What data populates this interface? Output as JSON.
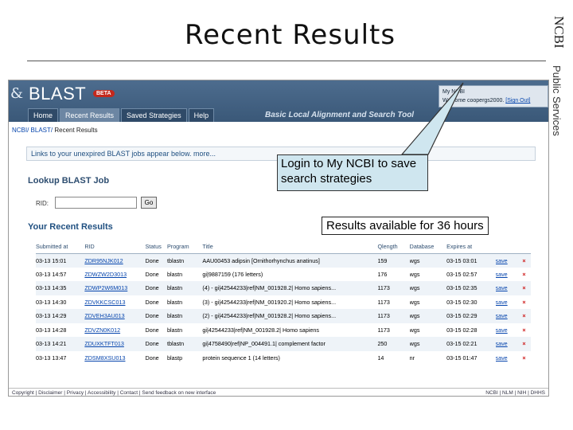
{
  "slide": {
    "title": "Recent Results",
    "side_brand": "NCBI",
    "side_label": "Public Services"
  },
  "blast": {
    "logo_text": "BLAST",
    "beta_badge": "BETA",
    "nav_tabs": [
      "Home",
      "Recent Results",
      "Saved Strategies",
      "Help"
    ],
    "tagline": "Basic Local Alignment and Search Tool",
    "signin_line1": "My NCBI",
    "signin_line2": "Welcome coopergs2000.",
    "signout_label": "[Sign Out]",
    "breadcrumb_prefix": "NCBI/ BLAST/",
    "breadcrumb_current": "Recent Results",
    "unexpired_text": "Links to your unexpired BLAST jobs appear below. more...",
    "lookup_heading": "Lookup BLAST Job",
    "rid_label": "RID:",
    "go_label": "Go",
    "results_heading": "Your Recent Results",
    "columns": [
      "Submitted at",
      "RID",
      "Status",
      "Program",
      "Title",
      "Qlength",
      "Database",
      "Expires at",
      "",
      ""
    ],
    "rows": [
      [
        "03-13 15:01",
        "ZDR95NJK012",
        "Done",
        "tblastn",
        "AAU00453 adipsin [Ornithorhynchus anatinus]",
        "159",
        "wgs",
        "03-15 03:01",
        "save",
        "×"
      ],
      [
        "03-13 14:57",
        "ZDWZW2D3013",
        "Done",
        "blastn",
        "gi|9887159 (176 letters)",
        "176",
        "wgs",
        "03-15 02:57",
        "save",
        "×"
      ],
      [
        "03-13 14:35",
        "ZDWP2W6M013",
        "Done",
        "blastn",
        "(4) - gi|42544233|ref|NM_001928.2| Homo sapiens...",
        "1173",
        "wgs",
        "03-15 02:35",
        "save",
        "×"
      ],
      [
        "03-13 14:30",
        "ZDVKKCSC013",
        "Done",
        "blastn",
        "(3) - gi|42544233|ref|NM_001920.2| Homo sapiens...",
        "1173",
        "wgs",
        "03-15 02:30",
        "save",
        "×"
      ],
      [
        "03-13 14:29",
        "ZDVEH3AU013",
        "Done",
        "blastn",
        "(2) - gi|42544233|ref|NM_001928.2| Homo sapiens...",
        "1173",
        "wgs",
        "03-15 02:29",
        "save",
        "×"
      ],
      [
        "03-13 14:28",
        "ZDVZN0K012",
        "Done",
        "blastn",
        "gi|42544233|ref|NM_001928.2| Homo sapiens",
        "1173",
        "wgs",
        "03-15 02:28",
        "save",
        "×"
      ],
      [
        "03-13 14:21",
        "ZDUXKTFT013",
        "Done",
        "tblastn",
        "gi|4758490|ref|NP_004491.1| complement factor",
        "250",
        "wgs",
        "03-15 02:21",
        "save",
        "×"
      ],
      [
        "03-13 13:47",
        "ZDSM8XSU013",
        "Done",
        "blastp",
        "protein sequence 1 (14 letters)",
        "14",
        "nr",
        "03-15 01:47",
        "save",
        "×"
      ]
    ],
    "footer_left": "Copyright | Disclaimer | Privacy | Accessibility | Contact | Send feedback on new interface",
    "footer_right": "NCBI | NLM | NIH | DHHS"
  },
  "callouts": {
    "login": "Login to My NCBI to save search strategies",
    "results": "Results available for 36 hours"
  },
  "colors": {
    "header_blue": "#3a5878",
    "link_blue": "#0645ad",
    "delete_red": "#cc1111",
    "callout_fill": "#cfe6ef"
  }
}
